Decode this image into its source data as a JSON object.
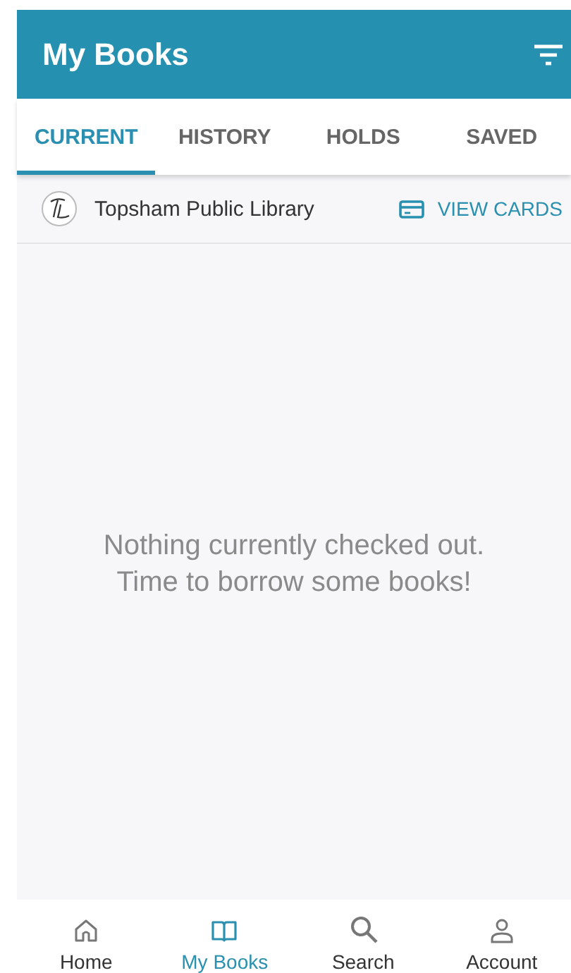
{
  "app_bar": {
    "title": "My Books"
  },
  "tabs": [
    {
      "label": "CURRENT",
      "selected": true
    },
    {
      "label": "HISTORY",
      "selected": false
    },
    {
      "label": "HOLDS",
      "selected": false
    },
    {
      "label": "SAVED",
      "selected": false
    }
  ],
  "library": {
    "name": "Topsham Public Library",
    "action": "VIEW CARDS"
  },
  "empty_message": [
    "Nothing currently checked out.",
    "Time to borrow some books!"
  ],
  "bottom_nav": [
    {
      "kind": "home",
      "label": "Home",
      "selected": false
    },
    {
      "kind": "books",
      "label": "My Books",
      "selected": true
    },
    {
      "kind": "search",
      "label": "Search",
      "selected": false
    },
    {
      "kind": "account",
      "label": "Account",
      "selected": false
    }
  ]
}
